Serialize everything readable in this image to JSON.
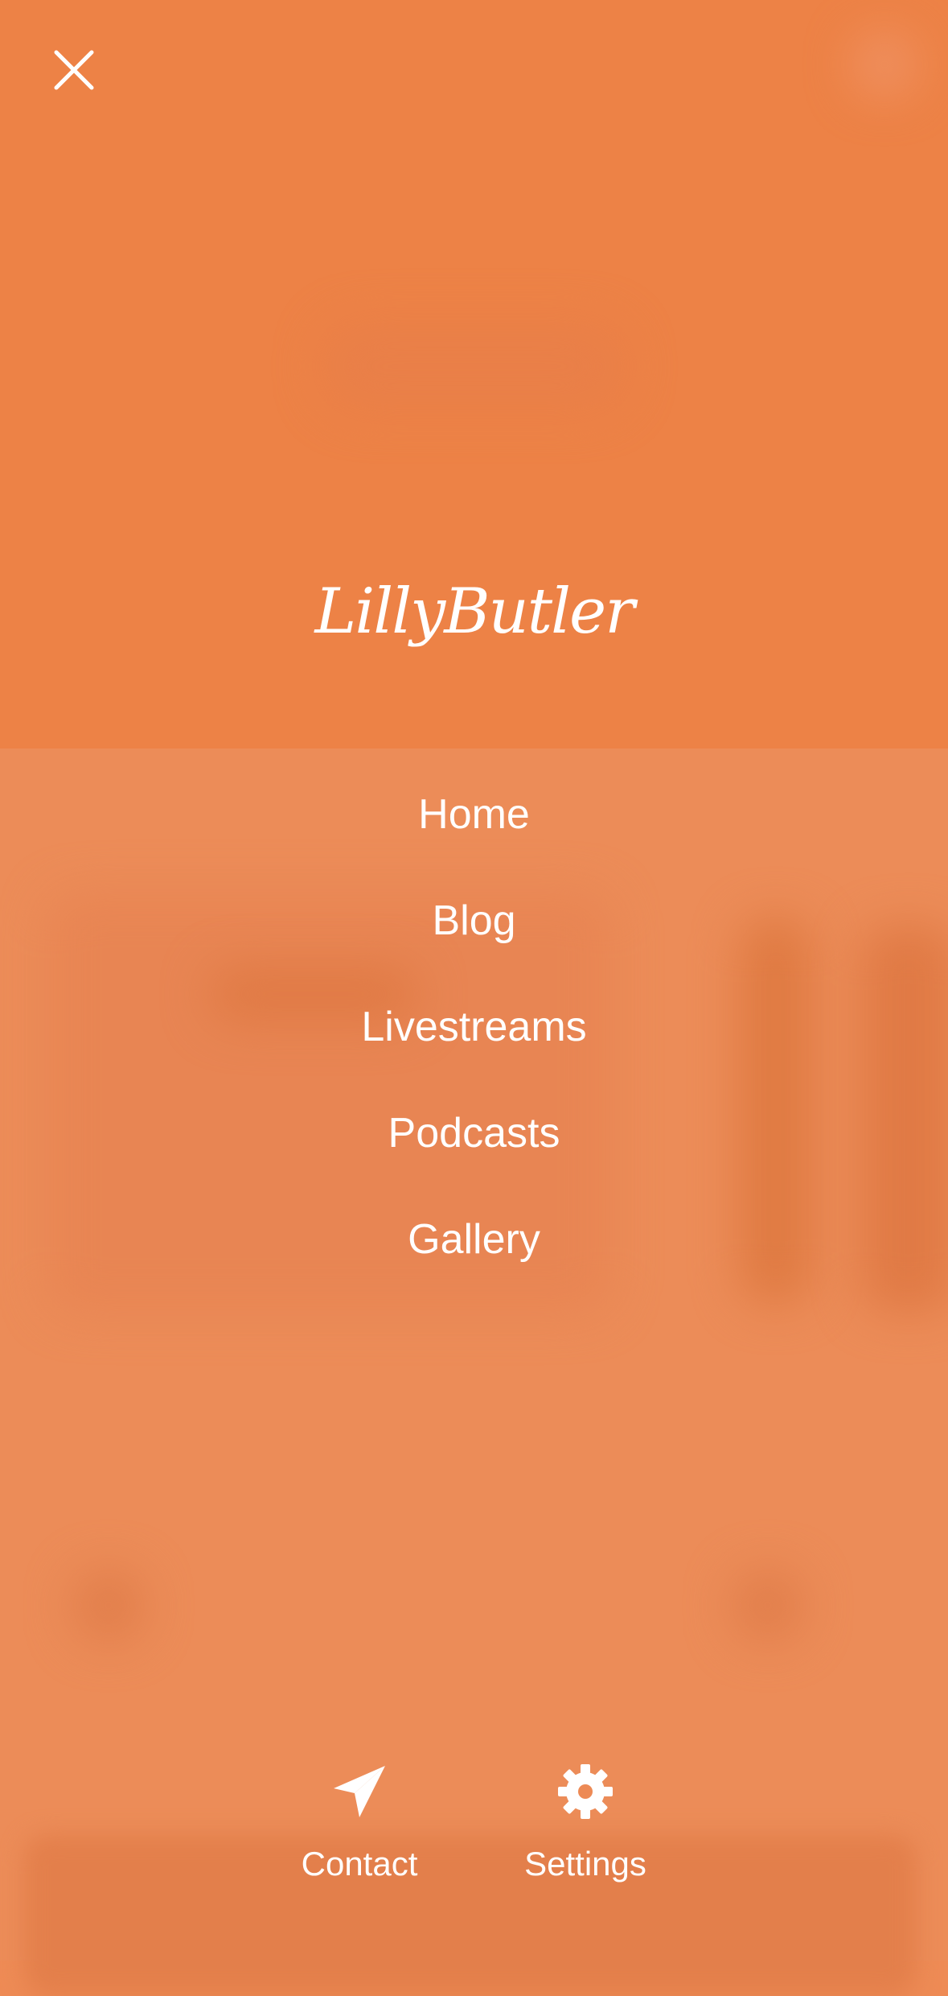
{
  "brand": {
    "logo_text": "LillyButler"
  },
  "menu": {
    "items": [
      {
        "label": "Home"
      },
      {
        "label": "Blog"
      },
      {
        "label": "Livestreams"
      },
      {
        "label": "Podcasts"
      },
      {
        "label": "Gallery"
      }
    ]
  },
  "footer_actions": {
    "contact_label": "Contact",
    "settings_label": "Settings"
  },
  "icons": {
    "close": "close-icon",
    "contact": "paper-plane-icon",
    "settings": "gear-icon"
  },
  "colors": {
    "overlay_top": "#ed8246",
    "overlay_bottom": "#ec8c58",
    "foreground": "#ffffff"
  }
}
